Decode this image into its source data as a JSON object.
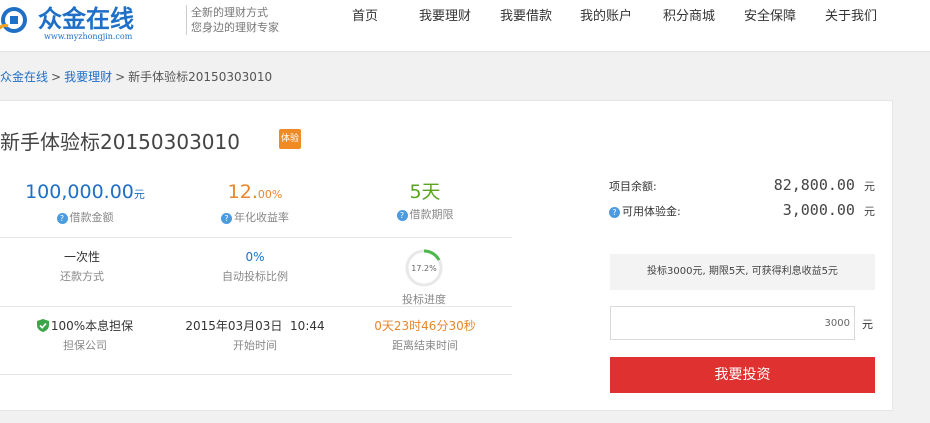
{
  "header": {
    "logo_text": "众金在线",
    "logo_url": "www.myzhongjin.com",
    "slogan_line1": "全新的理财方式",
    "slogan_line2": "您身边的理财专家",
    "nav": [
      "首页",
      "我要理财",
      "我要借款",
      "我的账户",
      "积分商城",
      "安全保障",
      "关于我们"
    ]
  },
  "breadcrumb": {
    "home": "众金在线",
    "section": "我要理财",
    "current": "新手体验标20150303010",
    "separator": ">"
  },
  "loan": {
    "title": "新手体验标20150303010",
    "badge": "体验",
    "amount_value": "100,000.00",
    "amount_unit": "元",
    "amount_label": "借款金额",
    "rate_value": "12.",
    "rate_decimal": "00%",
    "rate_label": "年化收益率",
    "term_value": "5天",
    "term_label": "借款期限",
    "repay_value": "一次性",
    "repay_label": "还款方式",
    "auto_value": "0%",
    "auto_label": "自动投标比例",
    "progress_value": "17.2%",
    "progress_percent": 17.2,
    "progress_label": "投标进度",
    "guarantee_value": "100%本息担保",
    "guarantee_label": "担保公司",
    "start_value": "2015年03月03日  10:44",
    "start_label": "开始时间",
    "countdown_value": "0天23时46分30秒",
    "countdown_label": "距离结束时间"
  },
  "invest": {
    "remaining_label": "项目余额:",
    "remaining_value": "82,800.00",
    "remaining_unit": "元",
    "available_label": "可用体验金:",
    "available_value": "3,000.00",
    "available_unit": "元",
    "tip": "投标3000元, 期限5天, 可获得利息收益5元",
    "input_value": "3000",
    "input_unit": "元",
    "button": "我要投资"
  },
  "colors": {
    "brand_blue": "#1f6fc7",
    "rate_orange": "#e8862a",
    "term_green": "#5aa51f",
    "countdown_orange": "#e8862a",
    "button_red": "#e03131",
    "badge_orange": "#f08a24",
    "progress_green": "#4cb84c"
  }
}
